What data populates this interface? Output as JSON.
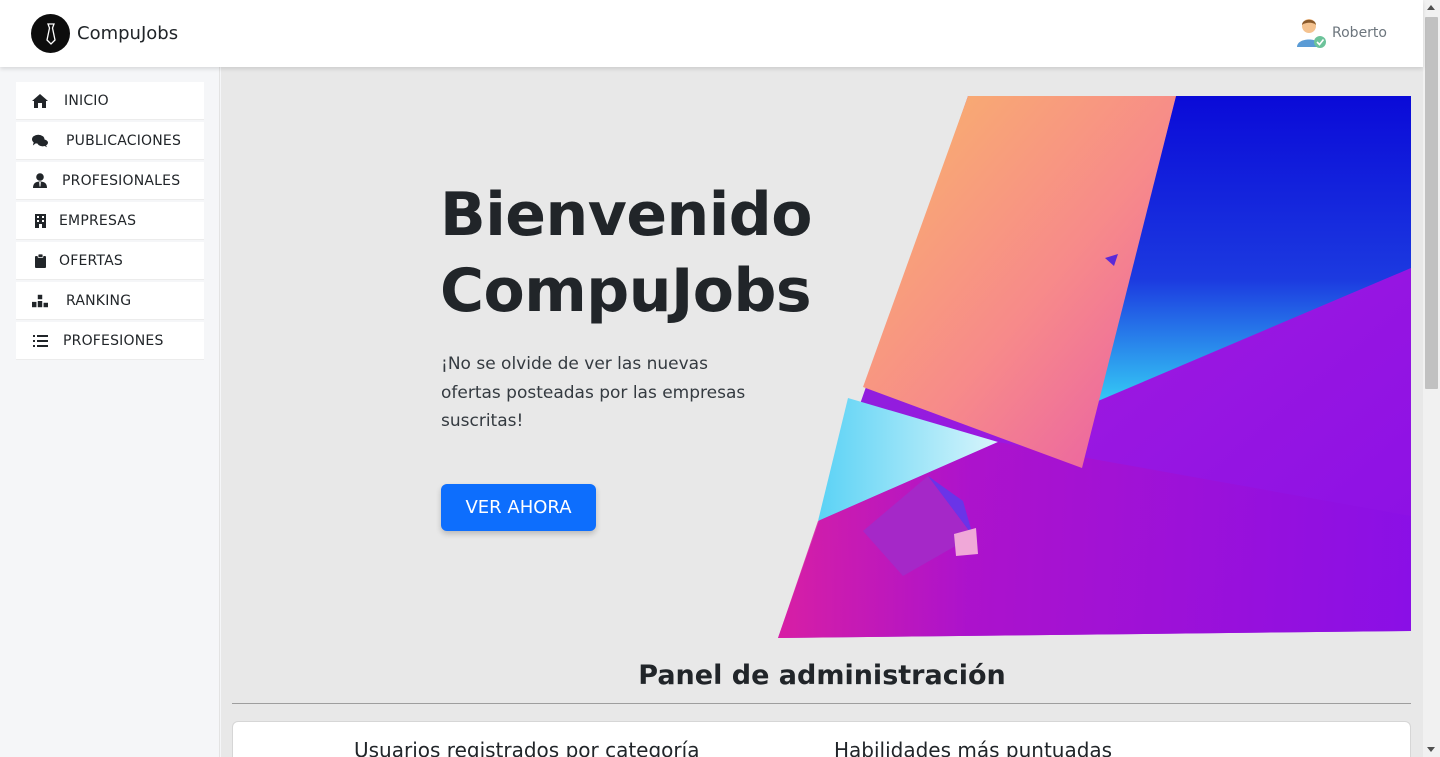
{
  "app": {
    "brand": "CompuJobs"
  },
  "user": {
    "name": "Roberto"
  },
  "sidebar": {
    "items": [
      {
        "label": "INICIO",
        "icon": "home-icon"
      },
      {
        "label": "PUBLICACIONES",
        "icon": "comments-icon"
      },
      {
        "label": "PROFESIONALES",
        "icon": "user-tie-icon"
      },
      {
        "label": "EMPRESAS",
        "icon": "building-icon"
      },
      {
        "label": "OFERTAS",
        "icon": "clipboard-icon"
      },
      {
        "label": "RANKING",
        "icon": "ranking-icon"
      },
      {
        "label": "PROFESIONES",
        "icon": "list-icon"
      }
    ]
  },
  "hero": {
    "title_line1": "Bienvenido",
    "title_line2": "CompuJobs",
    "text": "¡No se olvide de ver las nuevas ofertas posteadas por las empresas suscritas!",
    "button": "VER AHORA"
  },
  "panel": {
    "title": "Panel de administración",
    "cards": [
      {
        "title": "Usuarios registrados por categoría"
      },
      {
        "title": "Habilidades más puntuadas"
      }
    ]
  },
  "colors": {
    "accent": "#0d6efd",
    "main_bg": "#e8e8e8",
    "sidebar_bg": "#f5f6f8"
  }
}
